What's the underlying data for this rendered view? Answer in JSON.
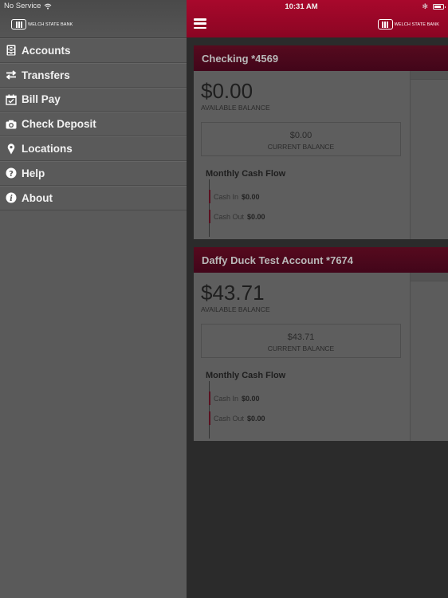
{
  "status_bar": {
    "carrier": "No Service",
    "time": "10:31 AM",
    "bluetooth": "✻"
  },
  "brand": {
    "name": "WELCH STATE BANK",
    "primary_color": "#a8082c",
    "card_header_color": "#4e0819"
  },
  "sidebar": {
    "items": [
      {
        "label": "Accounts",
        "icon": "file-cabinet-icon"
      },
      {
        "label": "Transfers",
        "icon": "transfer-arrows-icon"
      },
      {
        "label": "Bill Pay",
        "icon": "calendar-check-icon"
      },
      {
        "label": "Check Deposit",
        "icon": "camera-icon"
      },
      {
        "label": "Locations",
        "icon": "map-pin-icon"
      },
      {
        "label": "Help",
        "icon": "question-circle-icon"
      },
      {
        "label": "About",
        "icon": "info-circle-icon"
      }
    ]
  },
  "accounts": [
    {
      "title": "Checking *4569",
      "available_balance": "$0.00",
      "available_label": "AVAILABLE BALANCE",
      "current_balance": "$0.00",
      "current_label": "CURRENT BALANCE",
      "cash_flow_title": "Monthly Cash Flow",
      "cash_in_label": "Cash In",
      "cash_in": "$0.00",
      "cash_out_label": "Cash Out",
      "cash_out": "$0.00"
    },
    {
      "title": "Daffy Duck Test Account *7674",
      "available_balance": "$43.71",
      "available_label": "AVAILABLE BALANCE",
      "current_balance": "$43.71",
      "current_label": "CURRENT BALANCE",
      "cash_flow_title": "Monthly Cash Flow",
      "cash_in_label": "Cash In",
      "cash_in": "$0.00",
      "cash_out_label": "Cash Out",
      "cash_out": "$0.00"
    }
  ]
}
